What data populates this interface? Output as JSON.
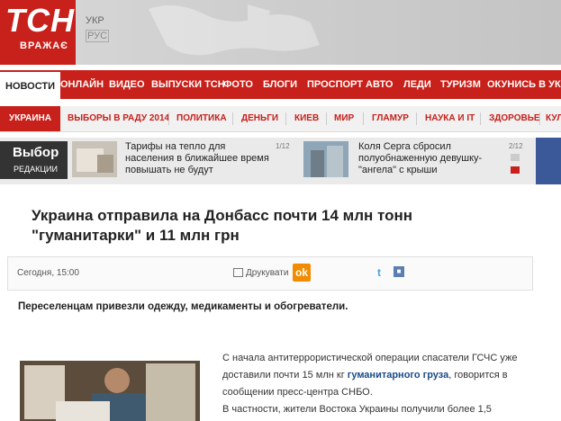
{
  "logo": {
    "name": "ТСН",
    "sub": "ВРАЖАЄ"
  },
  "lang": {
    "ukr": "УКР",
    "rus": "РУС"
  },
  "nav_main": [
    "НОВОСТИ",
    "ОНЛАЙН",
    "ВИДЕО",
    "ВЫПУСКИ ТСН",
    "ФОТО",
    "БЛОГИ",
    "ПРОСПОРТ",
    "АВТО",
    "ЛЕДИ",
    "ТУРИЗМ",
    "ОКУНИСЬ В УКРА"
  ],
  "nav_sub": [
    "УКРАИНА",
    "ВЫБОРЫ В РАДУ 2014",
    "ПОЛИТИКА",
    "ДЕНЬГИ",
    "КИЕВ",
    "МИР",
    "ГЛАМУР",
    "НАУКА И IT",
    "ЗДОРОВЬЕ",
    "КУЛЬ"
  ],
  "promo": {
    "vybor_title": "Выбор",
    "vybor_sub": "РЕДАКЦИИ",
    "item1_text": "Тарифы на тепло для населения в ближайшее время повышать не будут",
    "item1_count": "1/12",
    "item2_text": "Коля Серга сбросил полуобнаженную девушку-\"ангела\" с крыши",
    "item2_count": "2/12"
  },
  "article": {
    "title": "Украина отправила на Донбасс почти 14 млн тонн \"гуманитарки\" и 11 млн грн",
    "date": "Сегодня, 15:00",
    "print": "Друкувати",
    "ok": "ok",
    "lead": "Переселенцам привезли одежду, медикаменты и обогреватели.",
    "body1_a": "С начала антитеррористической операции спасатели ГСЧС уже доставили почти 15 млн кг ",
    "body1_link": "гуманитарного груза",
    "body1_b": ", говорится в сообщении пресс-центра СНБО.",
    "body2": "В частности, жители Востока Украины получили более 1,5"
  }
}
